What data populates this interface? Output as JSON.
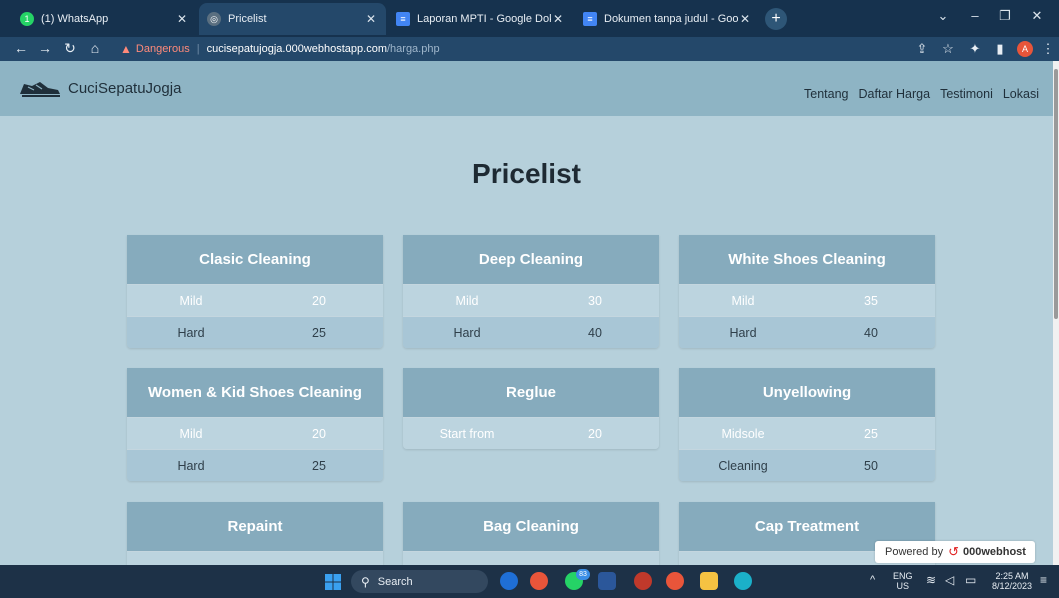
{
  "browser": {
    "tabs": [
      {
        "title": "(1) WhatsApp",
        "favicon": "whatsapp-icon",
        "color": "#25d366"
      },
      {
        "title": "Pricelist",
        "favicon": "globe-icon",
        "color": "#5a6f80"
      },
      {
        "title": "Laporan MPTI - Google Dokume…",
        "favicon": "docs-icon",
        "color": "#4285f4"
      },
      {
        "title": "Dokumen tanpa judul - Google D…",
        "favicon": "docs-icon",
        "color": "#4285f4"
      }
    ],
    "address": {
      "security": "Dangerous",
      "host": "cucisepatujogja.000webhostapp.com",
      "path": "/harga.php"
    },
    "profile_initial": "A"
  },
  "site": {
    "brand": "CuciSepatuJogja",
    "nav": [
      "Tentang",
      "Daftar Harga",
      "Testimoni",
      "Lokasi"
    ]
  },
  "page": {
    "title": "Pricelist",
    "cards": [
      {
        "title": "Clasic Cleaning",
        "rows": [
          {
            "name": "Mild",
            "price": "20"
          },
          {
            "name": "Hard",
            "price": "25"
          }
        ]
      },
      {
        "title": "Deep Cleaning",
        "rows": [
          {
            "name": "Mild",
            "price": "30"
          },
          {
            "name": "Hard",
            "price": "40"
          }
        ]
      },
      {
        "title": "White Shoes Cleaning",
        "rows": [
          {
            "name": "Mild",
            "price": "35"
          },
          {
            "name": "Hard",
            "price": "40"
          }
        ]
      },
      {
        "title": "Women & Kid Shoes Cleaning",
        "rows": [
          {
            "name": "Mild",
            "price": "20"
          },
          {
            "name": "Hard",
            "price": "25"
          }
        ]
      },
      {
        "title": "Reglue",
        "rows": [
          {
            "name": "Start from",
            "price": "20"
          }
        ]
      },
      {
        "title": "Unyellowing",
        "rows": [
          {
            "name": "Midsole",
            "price": "25"
          },
          {
            "name": "Cleaning",
            "price": "50"
          }
        ]
      },
      {
        "title": "Repaint",
        "rows": []
      },
      {
        "title": "Bag Cleaning",
        "rows": []
      },
      {
        "title": "Cap Treatment",
        "rows": []
      }
    ]
  },
  "powered": {
    "label": "Powered by",
    "brand": "000webhost"
  },
  "taskbar": {
    "search_label": "Search",
    "whatsapp_badge": "83",
    "lang_top": "ENG",
    "lang_bottom": "US",
    "time": "2:25 AM",
    "date": "8/12/2023"
  }
}
